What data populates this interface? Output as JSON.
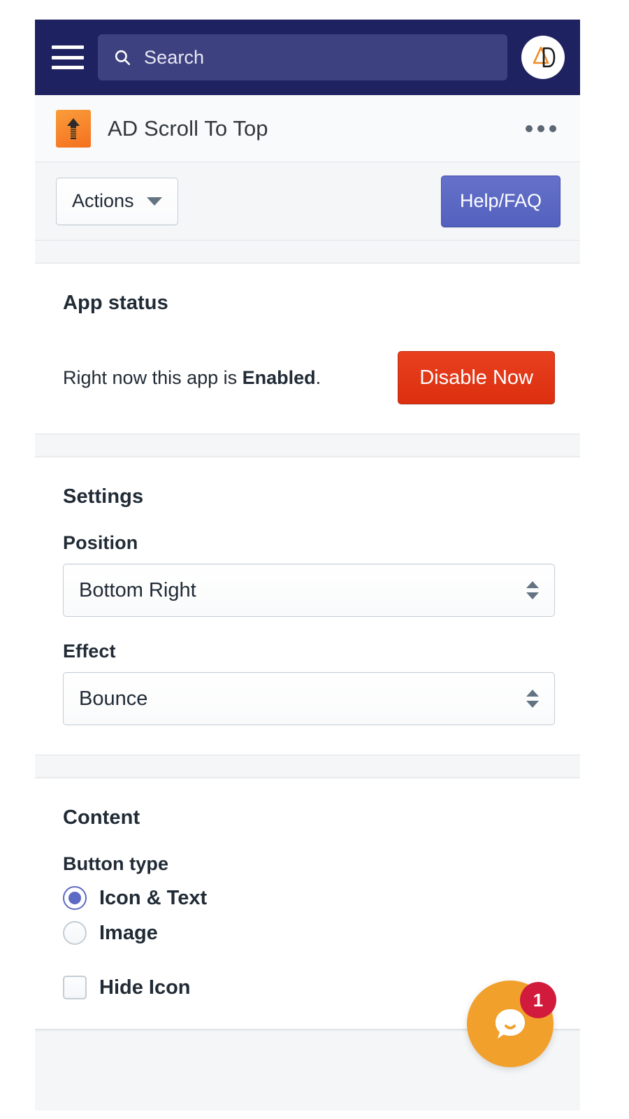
{
  "topbar": {
    "menu_icon": "hamburger-menu-icon",
    "search": {
      "icon": "search-icon",
      "placeholder": "Search",
      "value": ""
    },
    "avatar_icon": "merchant-logo-icon",
    "background_color": "#1f2260",
    "search_field_color": "#3e4180"
  },
  "page_header": {
    "app_icon": "scroll-to-top-arrow-icon",
    "app_icon_color": "#f4701f",
    "title": "AD Scroll To Top",
    "more_menu_icon": "kebab-menu-icon"
  },
  "action_bar": {
    "actions_label": "Actions",
    "actions_caret_icon": "chevron-down-icon",
    "help_label": "Help/FAQ",
    "help_color": "#5c6ac4"
  },
  "app_status": {
    "heading": "App status",
    "status_prefix": "Right now this app is ",
    "status_value": "Enabled",
    "status_suffix": ".",
    "disable_button_label": "Disable Now",
    "disable_button_color": "#e3331c"
  },
  "settings": {
    "heading": "Settings",
    "position": {
      "label": "Position",
      "value": "Bottom Right",
      "stepper_icon": "stepper-arrows-icon"
    },
    "effect": {
      "label": "Effect",
      "value": "Bounce",
      "stepper_icon": "stepper-arrows-icon"
    }
  },
  "content": {
    "heading": "Content",
    "button_type_label": "Button type",
    "options": [
      {
        "label": "Icon & Text",
        "selected": true
      },
      {
        "label": "Image",
        "selected": false
      }
    ],
    "hide_icon": {
      "label": "Hide Icon",
      "checked": false
    },
    "accent_color": "#5c6ac4"
  },
  "chat_widget": {
    "icon": "chat-bubble-icon",
    "badge_count": "1",
    "button_color": "#f2a02c",
    "badge_color": "#d21b3c"
  }
}
